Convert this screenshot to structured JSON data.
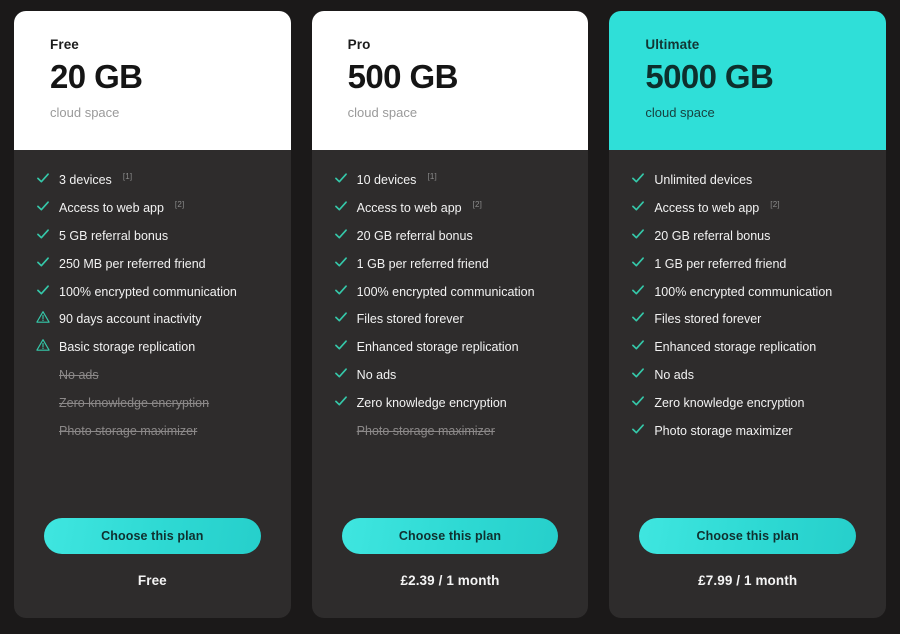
{
  "common": {
    "cloud_space_label": "cloud space",
    "choose_button_label": "Choose this plan",
    "icons": {
      "check": "check-icon",
      "warning": "warning-triangle-icon"
    },
    "colors": {
      "page_background": "#1b1919",
      "card_background": "#2e2c2c",
      "accent_teal": "#2fdfd8",
      "check_green": "#35c8a9",
      "warning_green": "#35c8a9",
      "disabled_text": "#8b8888",
      "header_light": "#ffffff"
    }
  },
  "plans": [
    {
      "name": "Free",
      "size": "20 GB",
      "size_sub": "cloud space",
      "header_style": "light",
      "price": "Free",
      "button_label": "Choose this plan",
      "features": [
        {
          "label": "3 devices",
          "note": "[1]",
          "state": "check"
        },
        {
          "label": "Access to web app",
          "note": "[2]",
          "state": "check"
        },
        {
          "label": "5 GB referral bonus",
          "note": "",
          "state": "check"
        },
        {
          "label": "250 MB per referred friend",
          "note": "",
          "state": "check"
        },
        {
          "label": "100% encrypted communication",
          "note": "",
          "state": "check"
        },
        {
          "label": "90 days account inactivity",
          "note": "",
          "state": "warning"
        },
        {
          "label": "Basic storage replication",
          "note": "",
          "state": "warning"
        },
        {
          "label": "No ads",
          "note": "",
          "state": "disabled"
        },
        {
          "label": "Zero knowledge encryption",
          "note": "",
          "state": "disabled"
        },
        {
          "label": "Photo storage maximizer",
          "note": "",
          "state": "disabled"
        }
      ]
    },
    {
      "name": "Pro",
      "size": "500 GB",
      "size_sub": "cloud space",
      "header_style": "light",
      "price": "£2.39 / 1 month",
      "button_label": "Choose this plan",
      "features": [
        {
          "label": "10 devices",
          "note": "[1]",
          "state": "check"
        },
        {
          "label": "Access to web app",
          "note": "[2]",
          "state": "check"
        },
        {
          "label": "20 GB referral bonus",
          "note": "",
          "state": "check"
        },
        {
          "label": "1 GB per referred friend",
          "note": "",
          "state": "check"
        },
        {
          "label": "100% encrypted communication",
          "note": "",
          "state": "check"
        },
        {
          "label": "Files stored forever",
          "note": "",
          "state": "check"
        },
        {
          "label": "Enhanced storage replication",
          "note": "",
          "state": "check"
        },
        {
          "label": "No ads",
          "note": "",
          "state": "check"
        },
        {
          "label": "Zero knowledge encryption",
          "note": "",
          "state": "check"
        },
        {
          "label": "Photo storage maximizer",
          "note": "",
          "state": "disabled"
        }
      ]
    },
    {
      "name": "Ultimate",
      "size": "5000 GB",
      "size_sub": "cloud space",
      "header_style": "accent",
      "price": "£7.99 / 1 month",
      "button_label": "Choose this plan",
      "features": [
        {
          "label": "Unlimited devices",
          "note": "",
          "state": "check"
        },
        {
          "label": "Access to web app",
          "note": "[2]",
          "state": "check"
        },
        {
          "label": "20 GB referral bonus",
          "note": "",
          "state": "check"
        },
        {
          "label": "1 GB per referred friend",
          "note": "",
          "state": "check"
        },
        {
          "label": "100% encrypted communication",
          "note": "",
          "state": "check"
        },
        {
          "label": "Files stored forever",
          "note": "",
          "state": "check"
        },
        {
          "label": "Enhanced storage replication",
          "note": "",
          "state": "check"
        },
        {
          "label": "No ads",
          "note": "",
          "state": "check"
        },
        {
          "label": "Zero knowledge encryption",
          "note": "",
          "state": "check"
        },
        {
          "label": "Photo storage maximizer",
          "note": "",
          "state": "check"
        }
      ]
    }
  ]
}
